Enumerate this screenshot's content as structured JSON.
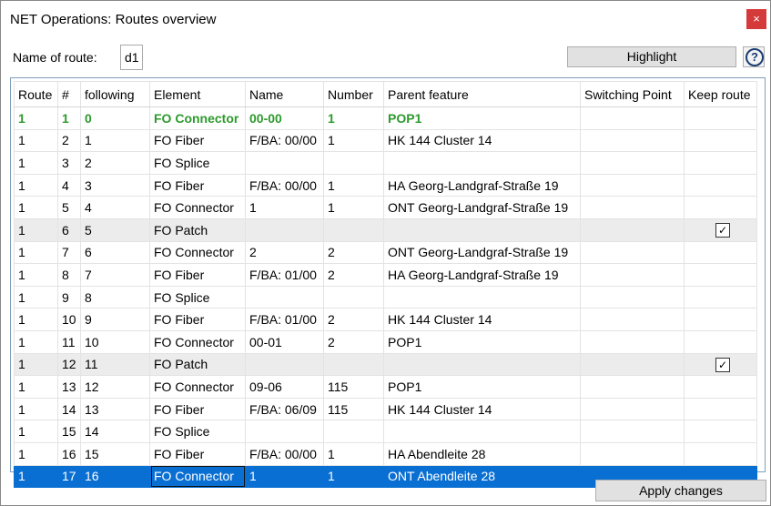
{
  "window": {
    "title": "NET Operations: Routes overview",
    "close_glyph": "×"
  },
  "route_name": {
    "label": "Name of route:",
    "value": "d1"
  },
  "highlight_label": "Highlight",
  "help_glyph": "?",
  "apply_label": "Apply changes",
  "columns": [
    "Route",
    "#",
    "following",
    "Element",
    "Name",
    "Number",
    "Parent feature",
    "Switching Point",
    "Keep route"
  ],
  "rows": [
    {
      "route": "1",
      "num": "1",
      "following": "0",
      "element": "FO Connector",
      "name": "00-00",
      "number": "1",
      "parent": "POP1",
      "switching": "",
      "keep": false,
      "style": "green"
    },
    {
      "route": "1",
      "num": "2",
      "following": "1",
      "element": "FO Fiber",
      "name": "F/BA: 00/00",
      "number": "1",
      "parent": "HK 144 Cluster 14",
      "switching": "",
      "keep": false,
      "style": ""
    },
    {
      "route": "1",
      "num": "3",
      "following": "2",
      "element": "FO Splice",
      "name": "",
      "number": "",
      "parent": "",
      "switching": "",
      "keep": false,
      "style": ""
    },
    {
      "route": "1",
      "num": "4",
      "following": "3",
      "element": "FO Fiber",
      "name": "F/BA: 00/00",
      "number": "1",
      "parent": "HA Georg-Landgraf-Straße 19",
      "switching": "",
      "keep": false,
      "style": ""
    },
    {
      "route": "1",
      "num": "5",
      "following": "4",
      "element": "FO Connector",
      "name": "1",
      "number": "1",
      "parent": "ONT Georg-Landgraf-Straße 19",
      "switching": "",
      "keep": false,
      "style": ""
    },
    {
      "route": "1",
      "num": "6",
      "following": "5",
      "element": "FO Patch",
      "name": "",
      "number": "",
      "parent": "",
      "switching": "",
      "keep": true,
      "style": "gray"
    },
    {
      "route": "1",
      "num": "7",
      "following": "6",
      "element": "FO Connector",
      "name": "2",
      "number": "2",
      "parent": "ONT Georg-Landgraf-Straße 19",
      "switching": "",
      "keep": false,
      "style": ""
    },
    {
      "route": "1",
      "num": "8",
      "following": "7",
      "element": "FO Fiber",
      "name": "F/BA: 01/00",
      "number": "2",
      "parent": "HA Georg-Landgraf-Straße 19",
      "switching": "",
      "keep": false,
      "style": ""
    },
    {
      "route": "1",
      "num": "9",
      "following": "8",
      "element": "FO Splice",
      "name": "",
      "number": "",
      "parent": "",
      "switching": "",
      "keep": false,
      "style": ""
    },
    {
      "route": "1",
      "num": "10",
      "following": "9",
      "element": "FO Fiber",
      "name": "F/BA: 01/00",
      "number": "2",
      "parent": "HK 144 Cluster 14",
      "switching": "",
      "keep": false,
      "style": ""
    },
    {
      "route": "1",
      "num": "11",
      "following": "10",
      "element": "FO Connector",
      "name": "00-01",
      "number": "2",
      "parent": "POP1",
      "switching": "",
      "keep": false,
      "style": ""
    },
    {
      "route": "1",
      "num": "12",
      "following": "11",
      "element": "FO Patch",
      "name": "",
      "number": "",
      "parent": "",
      "switching": "",
      "keep": true,
      "style": "gray"
    },
    {
      "route": "1",
      "num": "13",
      "following": "12",
      "element": "FO Connector",
      "name": "09-06",
      "number": "115",
      "parent": "POP1",
      "switching": "",
      "keep": false,
      "style": ""
    },
    {
      "route": "1",
      "num": "14",
      "following": "13",
      "element": "FO Fiber",
      "name": "F/BA: 06/09",
      "number": "115",
      "parent": "HK 144 Cluster 14",
      "switching": "",
      "keep": false,
      "style": ""
    },
    {
      "route": "1",
      "num": "15",
      "following": "14",
      "element": "FO Splice",
      "name": "",
      "number": "",
      "parent": "",
      "switching": "",
      "keep": false,
      "style": ""
    },
    {
      "route": "1",
      "num": "16",
      "following": "15",
      "element": "FO Fiber",
      "name": "F/BA: 00/00",
      "number": "1",
      "parent": "HA Abendleite 28",
      "switching": "",
      "keep": false,
      "style": ""
    },
    {
      "route": "1",
      "num": "17",
      "following": "16",
      "element": "FO Connector",
      "name": "1",
      "number": "1",
      "parent": "ONT Abendleite 28",
      "switching": "",
      "keep": false,
      "style": "sel"
    }
  ]
}
